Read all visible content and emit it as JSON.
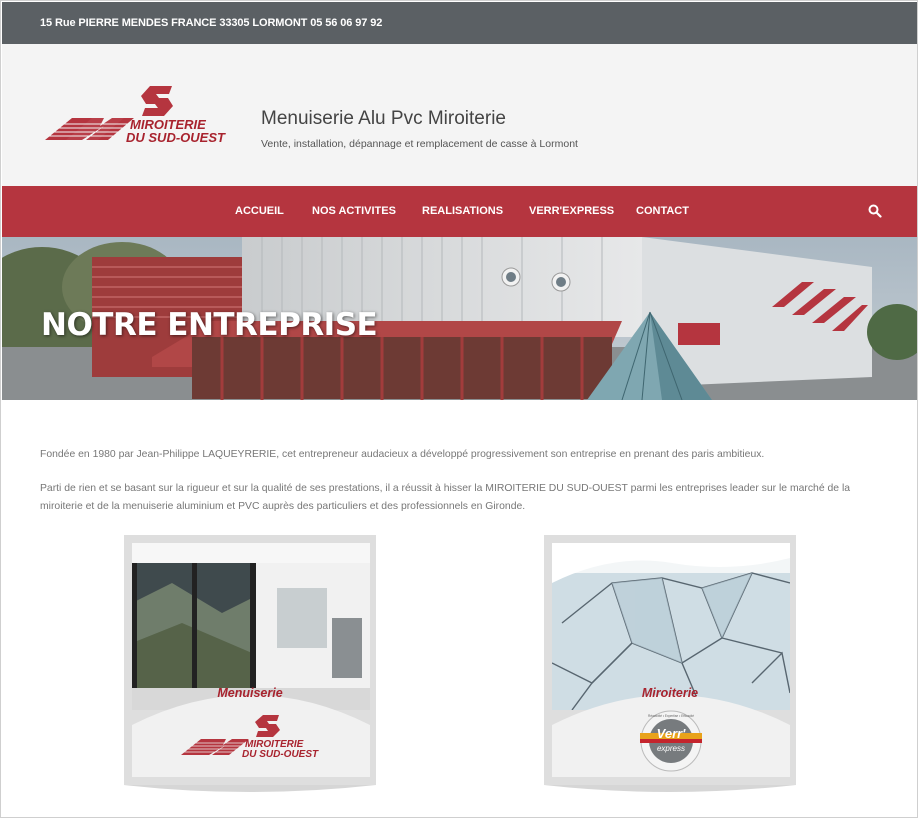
{
  "topbar": {
    "address": "15 Rue PIERRE MENDES FRANCE 33305 LORMONT 05 56 06 97 92"
  },
  "header": {
    "logo": {
      "line1": "MIROITERIE",
      "line2": "DU SUD-OUEST"
    },
    "title": "Menuiserie Alu Pvc Miroiterie",
    "tagline": "Vente, installation, dépannage et remplacement de casse à Lormont"
  },
  "nav": {
    "items": [
      {
        "label": "ACCUEIL"
      },
      {
        "label": "NOS ACTIVITES"
      },
      {
        "label": "REALISATIONS"
      },
      {
        "label": "VERR'EXPRESS"
      },
      {
        "label": "CONTACT"
      }
    ],
    "search_icon": "search-icon"
  },
  "hero": {
    "title": "NOTRE ENTREPRISE"
  },
  "content": {
    "paragraph1": "Fondée en 1980 par Jean-Philippe LAQUEYRERIE, cet entrepreneur audacieux a développé progressivement son entreprise en prenant des paris ambitieux.",
    "paragraph2": "Parti de rien et se basant sur la rigueur et sur la qualité de ses prestations, il a réussit à hisser la MIROITERIE DU SUD-OUEST parmi les entreprises leader sur le marché de la miroiterie et de la menuiserie aluminium et PVC auprès des particuliers et des professionnels en Gironde."
  },
  "cards": [
    {
      "label": "Menuiserie",
      "logo_line1": "MIROITERIE",
      "logo_line2": "DU SUD-OUEST"
    },
    {
      "label": "Miroiterie",
      "badge_main": "Verr'",
      "badge_sub": "express",
      "badge_ring": "Réactivité • Expertise • Efficacité"
    }
  ],
  "colors": {
    "brand_red": "#b5353f",
    "logo_red": "#a8232e",
    "topbar": "#5b6064",
    "header_bg": "#f4f4f4"
  }
}
